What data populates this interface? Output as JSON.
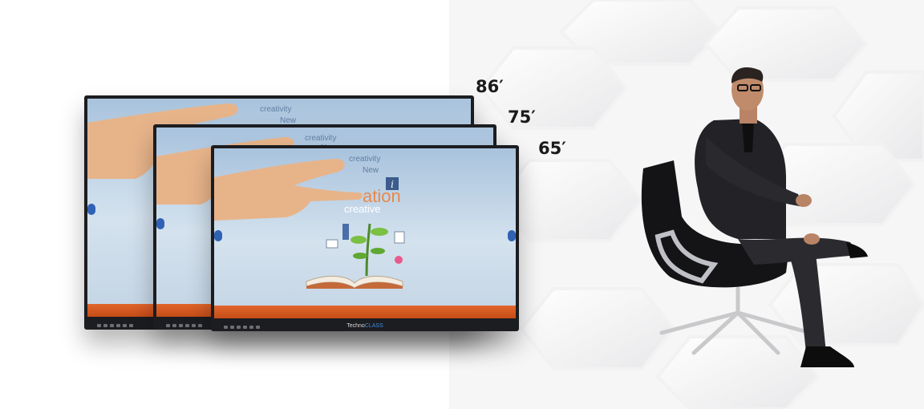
{
  "sizes": [
    "86′",
    "75′",
    "65′"
  ],
  "screen_text": {
    "creativity": "creativity",
    "new": "New",
    "ation": "ation",
    "creative": "creative"
  },
  "bezel_brand": {
    "prefix": "Techno",
    "suffix": "CLASS"
  },
  "icons": [
    "pointing-hand-icon",
    "open-book-icon",
    "plant-icon",
    "info-icon",
    "businessman-in-chair"
  ],
  "colors": {
    "taskbar": "#d85a22",
    "bezel": "#1c1d21",
    "accent_blue": "#2f62b5",
    "label_text": "#1a1a1a"
  }
}
